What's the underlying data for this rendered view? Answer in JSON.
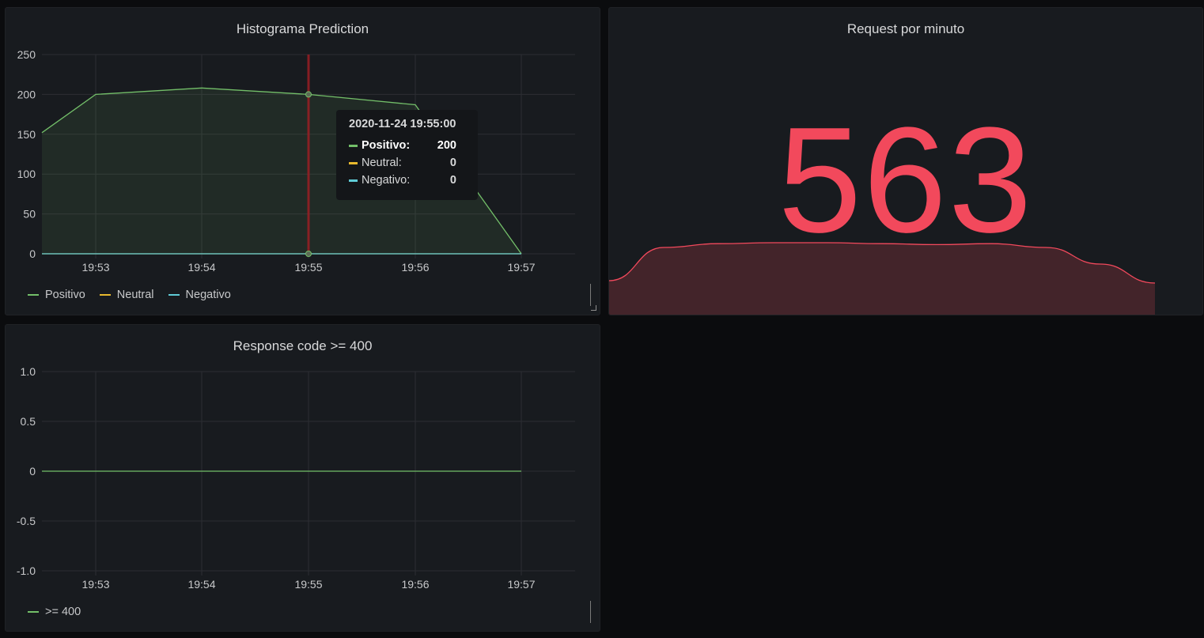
{
  "colors": {
    "positivo": "#73bf69",
    "neutral": "#e8b92e",
    "negativo": "#5fcbd6",
    "stat": "#f2495c",
    "crosshair": "#a01b22"
  },
  "panels": {
    "histogram": {
      "title": "Histograma Prediction",
      "tooltip": {
        "time": "2020-11-24 19:55:00",
        "rows": [
          {
            "name": "Positivo:",
            "value": "200"
          },
          {
            "name": "Neutral:",
            "value": "0"
          },
          {
            "name": "Negativo:",
            "value": "0"
          }
        ]
      },
      "legend": [
        "Positivo",
        "Neutral",
        "Negativo"
      ]
    },
    "requests": {
      "title": "Request por minuto",
      "value": "563"
    },
    "response": {
      "title": "Response code >= 400",
      "legend": [
        ">= 400"
      ]
    }
  },
  "chart_data": [
    {
      "type": "area",
      "title": "Histograma Prediction",
      "x": [
        "19:52:30",
        "19:53",
        "19:54",
        "19:55",
        "19:56",
        "19:57"
      ],
      "xticks": [
        "19:53",
        "19:54",
        "19:55",
        "19:56",
        "19:57"
      ],
      "yticks": [
        "250",
        "200",
        "150",
        "100",
        "50",
        "0"
      ],
      "ylim": [
        0,
        250
      ],
      "series": [
        {
          "name": "Positivo",
          "values": [
            152,
            200,
            208,
            200,
            187,
            0
          ]
        },
        {
          "name": "Neutral",
          "values": [
            0,
            0,
            0,
            0,
            0,
            0
          ]
        },
        {
          "name": "Negativo",
          "values": [
            0,
            0,
            0,
            0,
            0,
            0
          ]
        }
      ],
      "legend": "bottom-left",
      "grid": true
    },
    {
      "type": "line",
      "title": "Response code >= 400",
      "x": [
        "19:52:30",
        "19:53",
        "19:54",
        "19:55",
        "19:56",
        "19:57"
      ],
      "xticks": [
        "19:53",
        "19:54",
        "19:55",
        "19:56",
        "19:57"
      ],
      "yticks": [
        "1.0",
        "0.5",
        "0",
        "-0.5",
        "-1.0"
      ],
      "ylim": [
        -1,
        1
      ],
      "series": [
        {
          "name": ">= 400",
          "values": [
            0,
            0,
            0,
            0,
            0,
            0
          ]
        }
      ],
      "legend": "bottom-left",
      "grid": true
    },
    {
      "type": "area",
      "title": "Request por minuto (sparkline)",
      "values": [
        0,
        0.7,
        0.78,
        0.8,
        0.8,
        0.78,
        0.76,
        0.78,
        0.7,
        0.35,
        -0.05
      ]
    }
  ]
}
